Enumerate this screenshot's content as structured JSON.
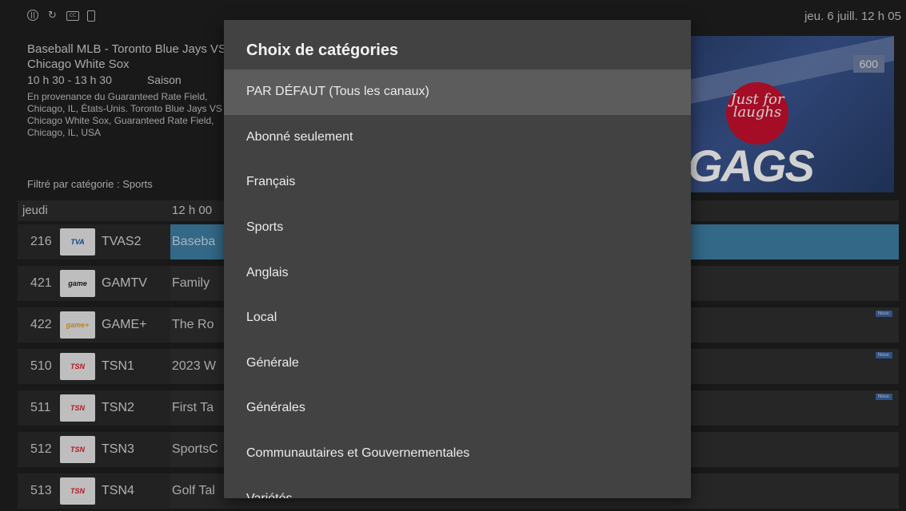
{
  "status_bar": {
    "icons": [
      "pause-circle-icon",
      "refresh-icon",
      "cc-icon",
      "phone-icon"
    ],
    "clock": "jeu. 6 juill.  12 h 05"
  },
  "program": {
    "title": "Baseball MLB - Toronto Blue Jays VS Chicago White Sox",
    "time_range": "10 h 30 - 13 h 30",
    "season": "Saison",
    "description": "En provenance du Guaranteed Rate Field, Chicago, IL, États-Unis. Toronto Blue Jays VS Chicago White Sox, Guaranteed Rate Field, Chicago, IL, USA"
  },
  "preview": {
    "channel_number": "600",
    "logo_text": "Just for laughs",
    "title_text": "GAGS"
  },
  "filter_label": "Filtré par catégorie : Sports",
  "grid": {
    "day": "jeudi",
    "time": "12 h 00",
    "rows": [
      {
        "number": "216",
        "logo": "TVA",
        "callsign": "TVAS2",
        "program": "Baseba",
        "selected": true,
        "new": false
      },
      {
        "number": "421",
        "logo": "game",
        "callsign": "GAMTV",
        "program": "Family",
        "selected": false,
        "new": false
      },
      {
        "number": "422",
        "logo": "game+",
        "callsign": "GAME+",
        "program": "The Ro",
        "selected": false,
        "new": true
      },
      {
        "number": "510",
        "logo": "TSN",
        "callsign": "TSN1",
        "program": "2023 W",
        "selected": false,
        "new": true
      },
      {
        "number": "511",
        "logo": "TSN",
        "callsign": "TSN2",
        "program": "First Ta",
        "selected": false,
        "new": true
      },
      {
        "number": "512",
        "logo": "TSN",
        "callsign": "TSN3",
        "program": "SportsC",
        "selected": false,
        "new": false
      },
      {
        "number": "513",
        "logo": "TSN",
        "callsign": "TSN4",
        "program": "Golf Tal",
        "selected": false,
        "new": false
      }
    ],
    "new_label": "Nouv."
  },
  "dialog": {
    "title": "Choix de catégories",
    "options": [
      "PAR DÉFAUT (Tous les canaux)",
      "Abonné seulement",
      "Français",
      "Sports",
      "Anglais",
      "Local",
      "Générale",
      "Générales",
      "Communautaires et Gouvernementales",
      "Variétés"
    ],
    "highlighted_index": 0
  },
  "colors": {
    "background": "#1f1f1f",
    "dialog": "#424242",
    "highlight": "#5c5c5c",
    "selected_program": "#3f7fa5"
  }
}
